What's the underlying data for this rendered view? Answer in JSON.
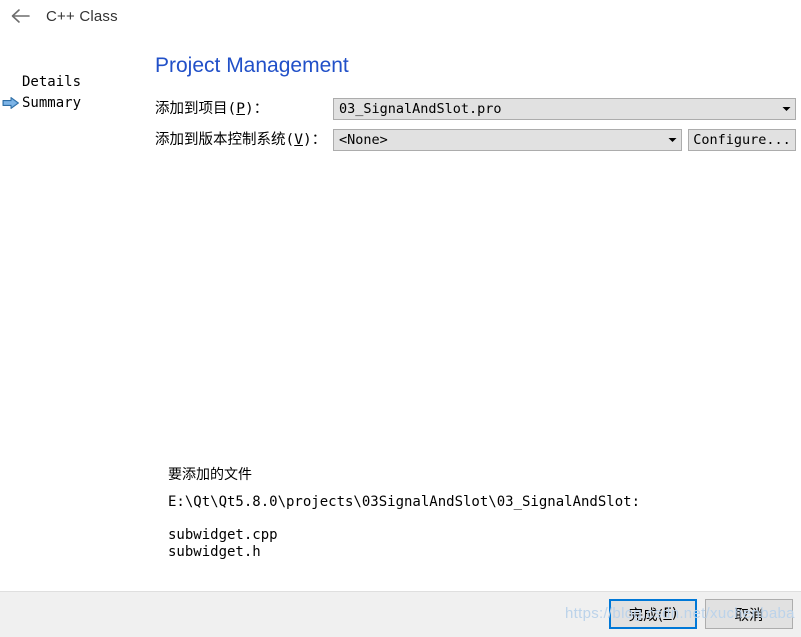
{
  "window": {
    "title": "C++ Class",
    "back_icon": "back-arrow-icon"
  },
  "sidebar": {
    "items": [
      {
        "label": "Details",
        "active": false,
        "marker": ""
      },
      {
        "label": "Summary",
        "active": true,
        "marker": "right-arrow-icon"
      }
    ]
  },
  "main": {
    "page_title": "Project Management",
    "form": {
      "project_row": {
        "label_prefix": "添加到项目(",
        "label_accel": "P",
        "label_suffix": ")：",
        "combo_value": "03_SignalAndSlot.pro",
        "arrow_icon": "chevron-down-icon"
      },
      "vcs_row": {
        "label_prefix": "添加到版本控制系统(",
        "label_accel": "V",
        "label_suffix": ")：",
        "combo_value": "<None>",
        "arrow_icon": "chevron-down-icon",
        "configure_label": "Configure..."
      }
    },
    "files": {
      "heading": "要添加的文件",
      "path": "E:\\Qt\\Qt5.8.0\\projects\\03SignalAndSlot\\03_SignalAndSlot:",
      "entries": [
        "subwidget.cpp",
        "subwidget.h"
      ]
    }
  },
  "footer": {
    "finish": {
      "prefix": "完成(",
      "accel": "F",
      "suffix": ")"
    },
    "cancel": {
      "label": "取消"
    }
  },
  "watermark": {
    "text": "https://blog.csdn.net/xuchenbaba"
  },
  "colors": {
    "title_blue": "#2150c8",
    "focus_blue": "#0078d7",
    "control_face": "#e1e1e1",
    "control_border": "#acacac",
    "footer_bg": "#f0f0f0",
    "watermark": "#bcd3ea"
  }
}
